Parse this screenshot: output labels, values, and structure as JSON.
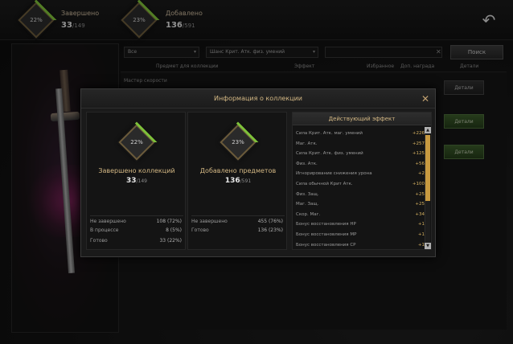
{
  "top_bar": {
    "completed": {
      "percent": "22%",
      "label": "Завершено",
      "count": "33",
      "total": "/149"
    },
    "added": {
      "percent": "23%",
      "label": "Добавлено",
      "count": "136",
      "total": "/591"
    }
  },
  "filter": {
    "category_value": "Все",
    "effect_value": "Шанс Крит. Атк. физ. умений",
    "search_value": "",
    "search_button": "Поиск"
  },
  "table": {
    "headers": {
      "items": "Предмет для коллекции",
      "effect": "Эффект",
      "favorite": "Избранное",
      "reward": "Доп. награда",
      "details": "Детали"
    },
    "row_title": "Мастер скорости",
    "detail_label": "Детали"
  },
  "modal": {
    "title": "Информация о коллекции",
    "completed_card": {
      "percent": "22%",
      "title": "Завершено коллекций",
      "count": "33",
      "total": "/149",
      "lines": [
        {
          "label": "Не завершено",
          "value": "108 (72%)"
        },
        {
          "label": "В процессе",
          "value": "8 (5%)"
        },
        {
          "label": "Готово",
          "value": "33 (22%)"
        }
      ]
    },
    "added_card": {
      "percent": "23%",
      "title": "Добавлено предметов",
      "count": "136",
      "total": "/591",
      "lines": [
        {
          "label": "Не завершено",
          "value": "455 (76%)"
        },
        {
          "label": "Готово",
          "value": "136 (23%)"
        }
      ]
    },
    "effect": {
      "header": "Действующий эффект",
      "rows": [
        {
          "label": "Сила Крит. Атк. маг. умений",
          "value": "+226"
        },
        {
          "label": "Маг. Атк.",
          "value": "+257"
        },
        {
          "label": "Сила Крит. Атк. физ. умений",
          "value": "+125"
        },
        {
          "label": "Физ. Атк.",
          "value": "+56"
        },
        {
          "label": "Игнорирование снижения урона",
          "value": "+2"
        },
        {
          "label": "Сила обычной Крит Атк.",
          "value": "+100"
        },
        {
          "label": "Физ. Защ.",
          "value": "+25"
        },
        {
          "label": "Маг. Защ.",
          "value": "+25"
        },
        {
          "label": "Скор. Маг.",
          "value": "+34"
        },
        {
          "label": "Бонус восстановления HP",
          "value": "+1"
        },
        {
          "label": "Бонус восстановления MP",
          "value": "+1"
        },
        {
          "label": "Бонус восстановления CP",
          "value": "+1"
        }
      ]
    }
  }
}
